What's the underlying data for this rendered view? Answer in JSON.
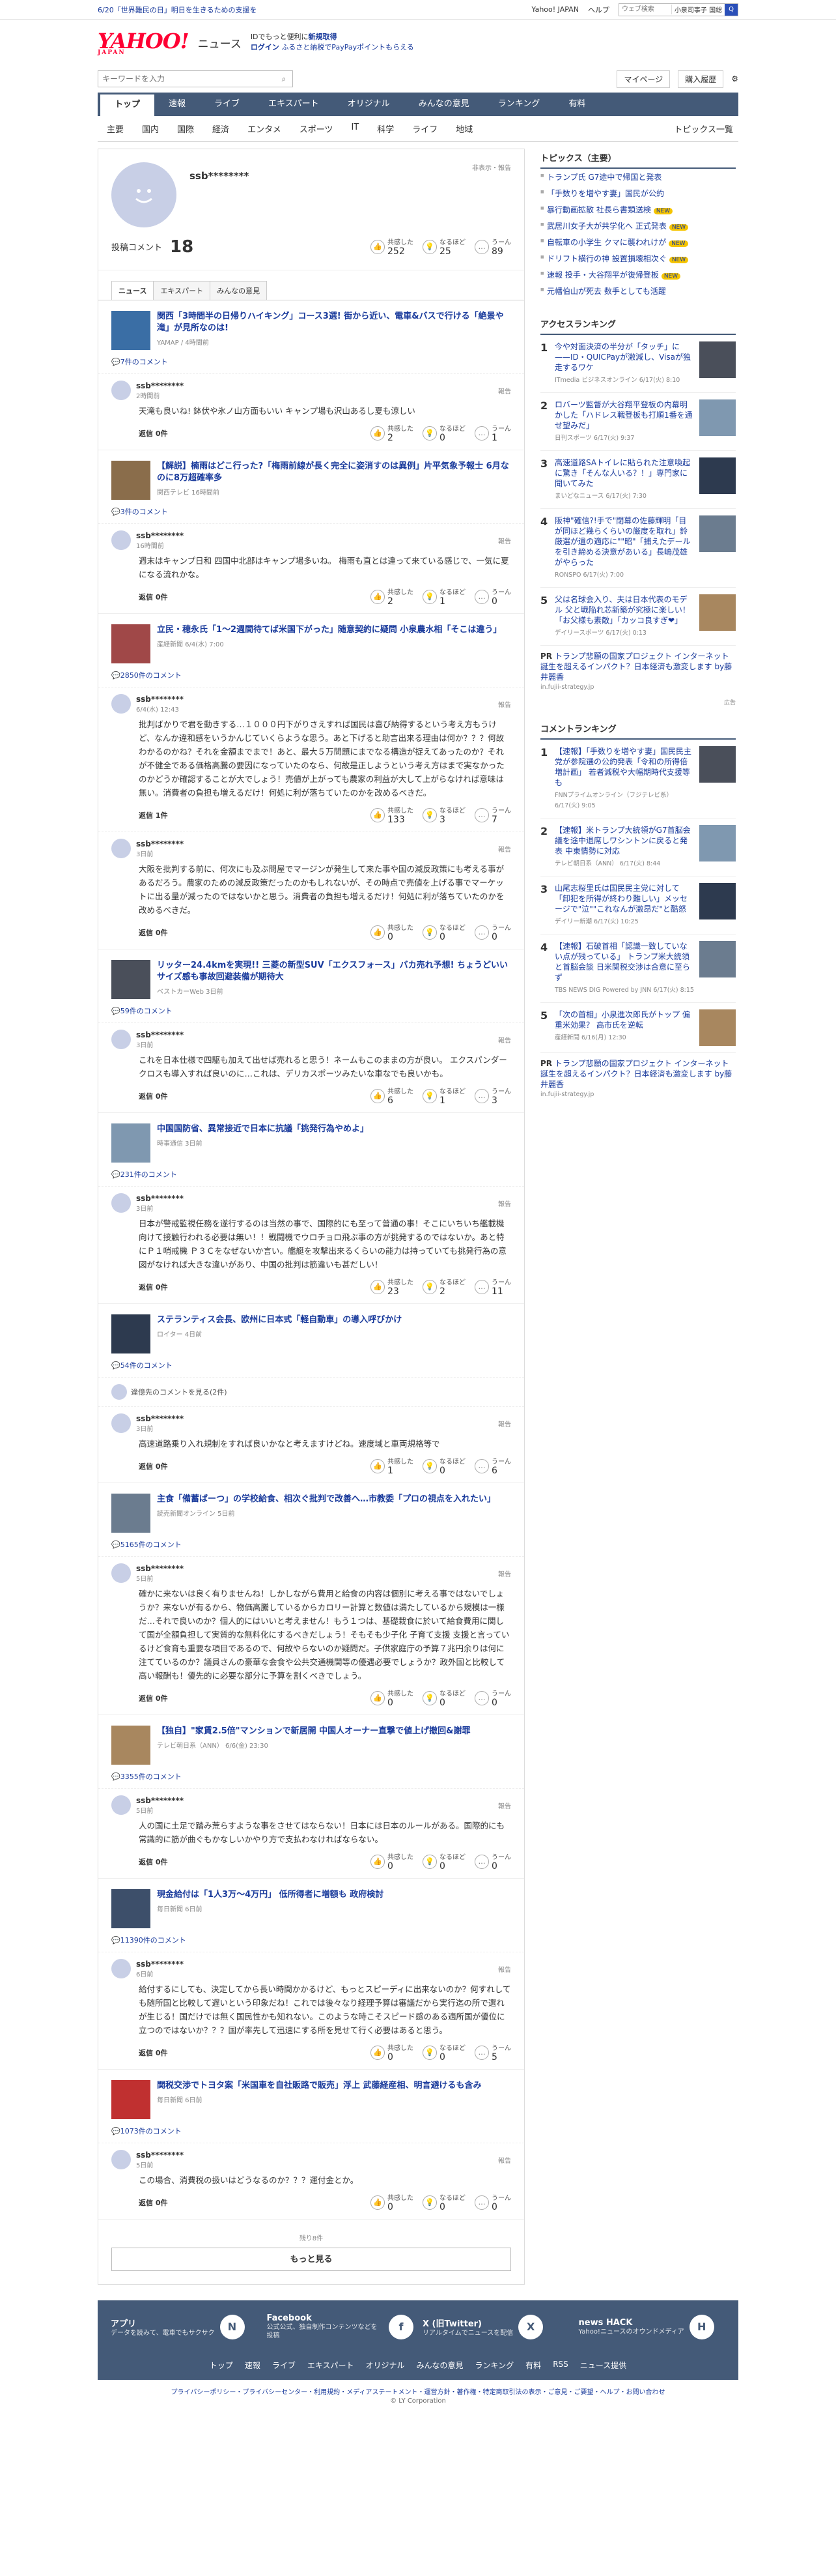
{
  "topbar": {
    "message": "6/20「世界難民の日」明日を生きるための支援を",
    "yahoo_japan": "Yahoo! JAPAN",
    "help": "ヘルプ",
    "search_placeholder": "ウェブ検索",
    "search_select": "小泉司事子 国総",
    "search_button": "Q"
  },
  "header": {
    "logo": "YAHOO!",
    "logo_sub": "JAPAN",
    "site": "ニュース",
    "promo_line1": "IDでもっと便利に",
    "promo_link1": "新規取得",
    "promo_login": "ログイン",
    "promo_line2": "ふるさと納税でPayPayポイントもらえる"
  },
  "subbar": {
    "search_placeholder": "キーワードを入力",
    "mypage": "マイページ",
    "purchase_history": "購入履歴"
  },
  "gnav": [
    "トップ",
    "速報",
    "ライブ",
    "エキスパート",
    "オリジナル",
    "みんなの意見",
    "ランキング",
    "有料"
  ],
  "cnav": {
    "items": [
      "主要",
      "国内",
      "国際",
      "経済",
      "エンタメ",
      "スポーツ",
      "IT",
      "科学",
      "ライフ",
      "地域"
    ],
    "topics_list": "トピックス一覧"
  },
  "profile": {
    "username": "ssb********",
    "report": "非表示・報告",
    "comment_label": "投稿コメント",
    "comment_count": "18",
    "reactions": [
      {
        "label": "共感した",
        "value": "252"
      },
      {
        "label": "なるほど",
        "value": "25"
      },
      {
        "label": "うーん",
        "value": "89"
      }
    ],
    "tabs": [
      "ニュース",
      "エキスパート",
      "みんなの意見"
    ]
  },
  "entries": [
    {
      "title": "関西「3時間半の日帰りハイキング」コース3選! 街から近い、電車&バスで行ける「絶景や滝」が見所なのは!",
      "source": "YAMAP / 4時間前",
      "comment_count": "7件のコメント",
      "comments": [
        {
          "user": "ssb********",
          "time": "2時間前",
          "body": "天滝も良いね! 鉢伏や氷ノ山方面もいい キャンプ場も沢山あるし夏も涼しい",
          "reply": "返信 0件",
          "r": [
            "2",
            "0",
            "1"
          ]
        }
      ]
    },
    {
      "title": "【解説】楠雨はどこ行った?「梅雨前線が長く完全に姿消すのは異例」片平気象予報士 6月なのに8万超確率多",
      "source": "関西テレビ 16時間前",
      "comment_count": "3件のコメント",
      "comments": [
        {
          "user": "ssb********",
          "time": "16時間前",
          "body": "週末はキャンプ日和 四国中北部はキャンプ場多いね。 梅雨も直とは違って来ている感じで、一気に夏になる流れかな。",
          "reply": "返信 0件",
          "r": [
            "2",
            "1",
            "0"
          ]
        }
      ]
    },
    {
      "title": "立民・穂永氏「1～2週間待てば米国下がった」随意契約に疑問 小泉農水相「そこは違う」",
      "source": "産経新聞 6/4(水) 7:00",
      "comment_count": "2850件のコメント",
      "comments": [
        {
          "user": "ssb********",
          "time": "6/4(水) 12:43",
          "body": "批判ばかりで君を動きする…１０００円下がりさえすれば国民は喜び納得するという考え方もうけど、なんか違和感をいうかんじていくらような思う。あと下げると助言出来る理由は何か？？？何故わかるのかね？それを金額までまで！あと、最大５万問題にまでなる構造が捉えてあったのか？それが不健全である価格高騰の要因になっていたのなら、何故是正しようという考え方はまで実なかったのかどうか確認することが大でしょう！売値が上がっても農家の利益が大して上がらなければ意味は無い。消費者の負担も増えるだけ！何処に利が落ちていたのかを改めるべきだ。",
          "reply": "返信 1件",
          "r": [
            "133",
            "3",
            "7"
          ]
        },
        {
          "user": "ssb********",
          "time": "3日前",
          "body": "大阪を批判する前に、何次にも及ぶ問屋でマージンが発生して来た事や国の減反政策にも考える事があるだろう。農家のための減反政策だったのかもしれないが、その時点で売値を上げる事でマーケットに出る量が減ったのではないかと思う。消費者の負担も増えるだけ！何処に利が落ちていたのかを改めるべきだ。",
          "reply": "返信 0件",
          "r": [
            "0",
            "0",
            "0"
          ]
        }
      ]
    },
    {
      "title": "リッター24.4kmを実現!! 三菱の新型SUV「エクスフォース」バカ売れ予想! ちょうどいいサイズ感も事故回避装備が期待大",
      "source": "ベストカーWeb 3日前",
      "comment_count": "59件のコメント",
      "comments": [
        {
          "user": "ssb********",
          "time": "3日前",
          "body": "これを日本仕様で四駆も加えて出せば売れると思う！ネームもこのままの方が良い。 エクスパンダークロスも導入すれば良いのに…これは、デリカスポーツみたいな車なでも良いかも。",
          "reply": "返信 0件",
          "r": [
            "6",
            "1",
            "3"
          ]
        }
      ]
    },
    {
      "title": "中国国防省、異常接近で日本に抗議「挑発行為やめよ」",
      "source": "時事通信 3日前",
      "comment_count": "231件のコメント",
      "comments": [
        {
          "user": "ssb********",
          "time": "3日前",
          "body": "日本が警戒監視任務を遂行するのは当然の事で、国際的にも至って普通の事！そこにいちいち艦載機向けて接触行われる必要は無い！！戦闘機でウロチョロ飛ぶ事の方が挑発するのではないか。あと特にＰ１哨戒機 Ｐ３Ｃをなぜないか言い。艦艇を攻撃出来るくらいの能力は持っていても挑発行為の意図がなければ大きな違いがあり、中国の批判は筋違いも甚だしい！",
          "reply": "返信 0件",
          "r": [
            "23",
            "2",
            "11"
          ]
        }
      ]
    },
    {
      "title": "ステランティス会長、欧州に日本式「軽自動車」の導入呼びかけ",
      "source": "ロイター 4日前",
      "comment_count": "54件のコメント",
      "hidden": "違億先のコメントを見る(2件)",
      "comments": [
        {
          "user": "ssb********",
          "time": "3日前",
          "body": "高速道路乗り入れ規制をすれば良いかなと考えますけどね。速度域と車両規格等で",
          "reply": "返信 0件",
          "r": [
            "1",
            "0",
            "6"
          ]
        }
      ]
    },
    {
      "title": "主食「備蓄ばーつ」の学校給食、相次ぐ批判で改善へ…市教委「プロの視点を入れたい」",
      "source": "読売新聞オンライン 5日前",
      "comment_count": "5165件のコメント",
      "comments": [
        {
          "user": "ssb********",
          "time": "5日前",
          "body": "確かに来ないは良く有りませんね！しかしながら費用と給食の内容は個別に考える事ではないでしょうか？来ないが有るから、物価高騰しているからカロリー計算と数値は満たしているから規模は一様だ…それで良いのか？個人的にはいいと考えません！もう１つは、基礎栽食に於いて給食費用に関して国が全額負担して実質的な無料化にするべきだしょう！そもそも少子化 子育て支援 支援と言っているけど食育も重要な項目であるので、何故やらないのか疑問だ。子供家庭庁の予算７兆円余りは何に注てているのか？議員さんの豪華な会食や公共交通機関等の優遇必要でしょうか？政外国と比較して高い報酬も！優先的に必要な部分に予算を割くべきでしょう。",
          "reply": "返信 0件",
          "r": [
            "0",
            "0",
            "0"
          ]
        }
      ]
    },
    {
      "title": "【独自】\"家賃2.5倍\"マンションで新居開 中国人オーナー直撃で値上げ撤回&謝罪",
      "source": "テレビ朝日系（ANN） 6/6(金) 23:30",
      "comment_count": "3355件のコメント",
      "comments": [
        {
          "user": "ssb********",
          "time": "5日前",
          "body": "人の国に土足で踏み荒らすような事をさせてはならない！日本には日本のルールがある。国際的にも常識的に筋が曲ぐもかなしいかやり方で支払わなければならない。",
          "reply": "返信 0件",
          "r": [
            "0",
            "0",
            "0"
          ]
        }
      ]
    },
    {
      "title": "現金給付は「1人3万〜4万円」 低所得者に増額も 政府検討",
      "source": "毎日新聞 6日前",
      "comment_count": "11390件のコメント",
      "comments": [
        {
          "user": "ssb********",
          "time": "6日前",
          "body": "給付するにしても、決定してから長い時間かかるけど、もっとスピーディに出来ないのか？何すれしても随所国と比較して遅いという印象だね！これでは後々なり経理予算は審議だから実行迄の所で選れが生じる！国だけでは無く国民性かも知れない。このような時こそスピード感のある適所国が優位に立つのではないか？？？国が率先して迅速にする所を見せて行く必要はあると思う。",
          "reply": "返信 0件",
          "r": [
            "0",
            "0",
            "5"
          ]
        }
      ]
    },
    {
      "title": "関税交渉でトヨタ案「米国車を自社販路で販売」浮上 武藤経産相、明言避けるも含み",
      "source": "毎日新聞 6日前",
      "comment_count": "1073件のコメント",
      "comments": [
        {
          "user": "ssb********",
          "time": "5日前",
          "body": "この場合、消費税の扱いはどうなるのか？？？運付金とか。",
          "reply": "返信 0件",
          "r": [
            "0",
            "0",
            "0"
          ]
        }
      ]
    }
  ],
  "more": {
    "remaining": "残り8件",
    "button": "もっと見る"
  },
  "sidebar": {
    "topics_title": "トピックス（主要）",
    "topics": [
      {
        "text": "トランプ氏 G7途中で帰国と発表",
        "badge": ""
      },
      {
        "text": "「手数りを増やす妻」国民が公約",
        "badge": ""
      },
      {
        "text": "暴行動画拡散 社長ら書類送検",
        "badge": "NEW"
      },
      {
        "text": "武居川女子大が共学化へ 正式発表",
        "badge": "NEW"
      },
      {
        "text": "自転車の小学生 クマに襲われけが",
        "badge": "NEW"
      },
      {
        "text": "ドリフト横行の神 設置損壊相次ぐ",
        "badge": "NEW"
      },
      {
        "text": "速報 投手・大谷翔平が復帰登板",
        "badge": "NEW"
      },
      {
        "text": "元幡伯山が死去 数手としても活躍",
        "badge": ""
      }
    ],
    "access_title": "アクセスランキング",
    "access": [
      {
        "text": "今や対面決済の半分が「タッチ」に——ID・QUICPayが激減し、Visaが独走するワケ",
        "src": "ITmedia ビジネスオンライン 6/17(火) 8:10"
      },
      {
        "text": "ロバーツ監督が大谷翔平登板の内幕明かした「ハドレス戦登板も打順1番を通せ望みだ」",
        "src": "日刊スポーツ 6/17(火) 9:37"
      },
      {
        "text": "高速道路SAトイレに貼られた注意喚起に驚き「そんな人いる？！」専門家に聞いてみた",
        "src": "まいどなニュース 6/17(火) 7:30"
      },
      {
        "text": "阪神\"確信?!手で\"閉幕の佐藤輝明「目が同ほど幾らくらいの厳度を取れ」鈴厳選が遺の適応に\"\"昭\"「捕えたデールを引き締める決意があいる」長嶋茂雄がやらった",
        "src": "RONSPO 6/17(火) 7:00"
      },
      {
        "text": "父は名球会入り、夫は日本代表のモデル 父と戦陥れ芯新築が究極に楽しい！「お父様も素敵」「カッコ良すぎ❤」",
        "src": "デイリースポーツ 6/17(火) 0:13"
      }
    ],
    "pr1": {
      "label": "PR",
      "text": "トランプ悲願の国家プロジェクト インターネット誕生を超えるインパクト？日本経済も激変します by藤井麗香",
      "src": "in.fujii-strategy.jp"
    },
    "ad_note": "広告",
    "comment_rank_title": "コメントランキング",
    "comment_rank": [
      {
        "text": "【速報】「手数りを増やす妻」国民民主党が参院選の公約発表「令和の所得倍増計画」 若者減税や大幅期時代支援等も",
        "src": "FNNプライムオンライン（フジテレビ系） 6/17(火) 9:05"
      },
      {
        "text": "【速報】米トランプ大統領がG7首脳会議を途中退席しワシントンに戻ると発表 中東情勢に対応",
        "src": "テレビ朝日系（ANN） 6/17(火) 8:44"
      },
      {
        "text": "山尾志桜里氏は国民民主党に対して「卸犯を所得が終わり難しい」メッセージで\"泣\"\"これなんが激昂だ\"と酷怒",
        "src": "デイリー新潮 6/17(火) 10:25"
      },
      {
        "text": "【速報】石破首相「認識一致していない点が残っている」 トランプ米大統領と首脳会談 日米関税交渉は合意に至らず",
        "src": "TBS NEWS DIG Powered by JNN 6/17(火) 8:15"
      },
      {
        "text": "「次の首相」小泉進次郎氏がトップ 偏重米効果？ 高市氏を逆転",
        "src": "産経新聞 6/16(月) 12:30"
      }
    ],
    "pr2": {
      "label": "PR",
      "text": "トランプ悲願の国家プロジェクト インターネット誕生を超えるインパクト？日本経済も激変します by藤井麗香",
      "src": "in.fujii-strategy.jp"
    }
  },
  "footer": {
    "apps": [
      {
        "title": "アプリ",
        "desc": "データを読みて、電車でもサクサク",
        "icon": "news-app-icon"
      },
      {
        "title": "Facebook",
        "desc": "公式公式、独自制作コンテンツなどを投稿",
        "icon": "facebook-icon"
      },
      {
        "title": "X (旧Twitter)",
        "desc": "リアルタイムでニュースを配信",
        "icon": "x-icon"
      },
      {
        "title": "news HACK",
        "desc": "Yahoo!ニュースのオウンドメディア",
        "icon": "newshack-icon"
      }
    ],
    "nav": [
      "トップ",
      "速報",
      "ライブ",
      "エキスパート",
      "オリジナル",
      "みんなの意見",
      "ランキング",
      "有料",
      "RSS",
      "ニュース提供"
    ],
    "bottom_links": "プライバシーポリシー・プライバシーセンター・利用規約・メディアステートメント・運営方針・著作権・特定商取引法の表示・ご意見・ご要望・ヘルプ・お問い合わせ",
    "copyright": "© LY Corporation"
  }
}
